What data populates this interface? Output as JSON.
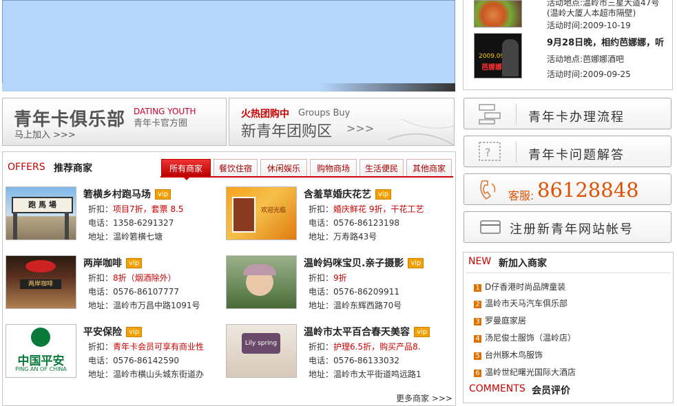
{
  "events": [
    {
      "line1": "活动地点:温岭市三星大道47号",
      "line2": "(温岭大厦人本超市隔壁)",
      "date": "活动时间:2009-10-19"
    },
    {
      "title": "9月28日晚，相约芭娜娜，听",
      "place": "活动地点:芭娜娜酒吧",
      "date": "活动时间:2009-09-25",
      "poster": {
        "l1": "2009.09.28",
        "l2": "芭娜娜"
      }
    }
  ],
  "promos": {
    "club": {
      "title": "青年卡俱乐部",
      "en": "DATING YOUTH",
      "sub": "青年卡官方圈",
      "join": "马上加入 >>>"
    },
    "groupbuy": {
      "hot": "火热团购中",
      "en": "Groups Buy",
      "title": "新青年团购区",
      "arrows": ">>>"
    }
  },
  "offers": {
    "en": "OFFERS",
    "cn": "推荐商家",
    "tabs": [
      "所有商家",
      "餐饮住宿",
      "休闲娱乐",
      "购物商场",
      "生活便民",
      "其他商家"
    ],
    "vip": "vip",
    "labels": {
      "discount": "折扣：",
      "phone": "电话：",
      "address": "地址："
    },
    "more": "更多商家 >>>",
    "merchants": [
      {
        "name": "箬横乡村跑马场",
        "discount": "项目7折，套票 8.5",
        "phone": "1358-6291327",
        "address": "温岭箬横七塘",
        "sign": "跑 馬 場"
      },
      {
        "name": "含羞草婚庆花艺",
        "discount": "婚庆鲜花 9折，干花工艺",
        "phone": "0576-86123198",
        "address": "万寿路43号",
        "sign": "欢迎光临"
      },
      {
        "name": "两岸咖啡",
        "discount": "8折（烟酒除外）",
        "phone": "0576-86107777",
        "address": "温岭市万昌中路1091号",
        "sign": "两岸咖啡"
      },
      {
        "name": "温岭妈咪宝贝.亲子摄影",
        "discount": "9折",
        "phone": "0576-86209911",
        "address": "温岭东辉西路70号",
        "sign": ""
      },
      {
        "name": "平安保险",
        "discount": "青年卡会员可享有商业性",
        "phone": "0576-86142590",
        "address": "温岭市横山头城东街道办",
        "logo_cn": "中国平安",
        "logo_en": "PING AN OF CHINA"
      },
      {
        "name": "温岭市太平百合春天美容",
        "discount": "护理6.5折，购买产品8.",
        "phone": "0576-86133032",
        "address": "温岭市太平街道鸣远路1",
        "sign": "Lily spring"
      }
    ]
  },
  "services": [
    {
      "label": "青年卡办理流程",
      "icon": "flowchart-icon"
    },
    {
      "label": "青年卡问题解答",
      "icon": "question-icon"
    },
    {
      "label_prefix": "客服:",
      "label": "86128848",
      "icon": "phone-icon"
    },
    {
      "label": "注册新青年网站帐号",
      "icon": "card-icon"
    }
  ],
  "new_merchants": {
    "en": "NEW",
    "cn": "新加入商家",
    "items": [
      "D仔香港时尚品牌童装",
      "温岭市天马汽车俱乐部",
      "罗曼庭家居",
      "汤尼俊士服饰（温岭店）",
      "台州豚木鸟服饰",
      "温岭世纪曙光国际大酒店"
    ]
  },
  "comments": {
    "en": "COMMENTS",
    "cn": "会员评价"
  },
  "colors": {
    "accent": "#cc0000",
    "banner": "#b5d6fb",
    "vip": "#f0a000",
    "phone": "#e05000"
  }
}
